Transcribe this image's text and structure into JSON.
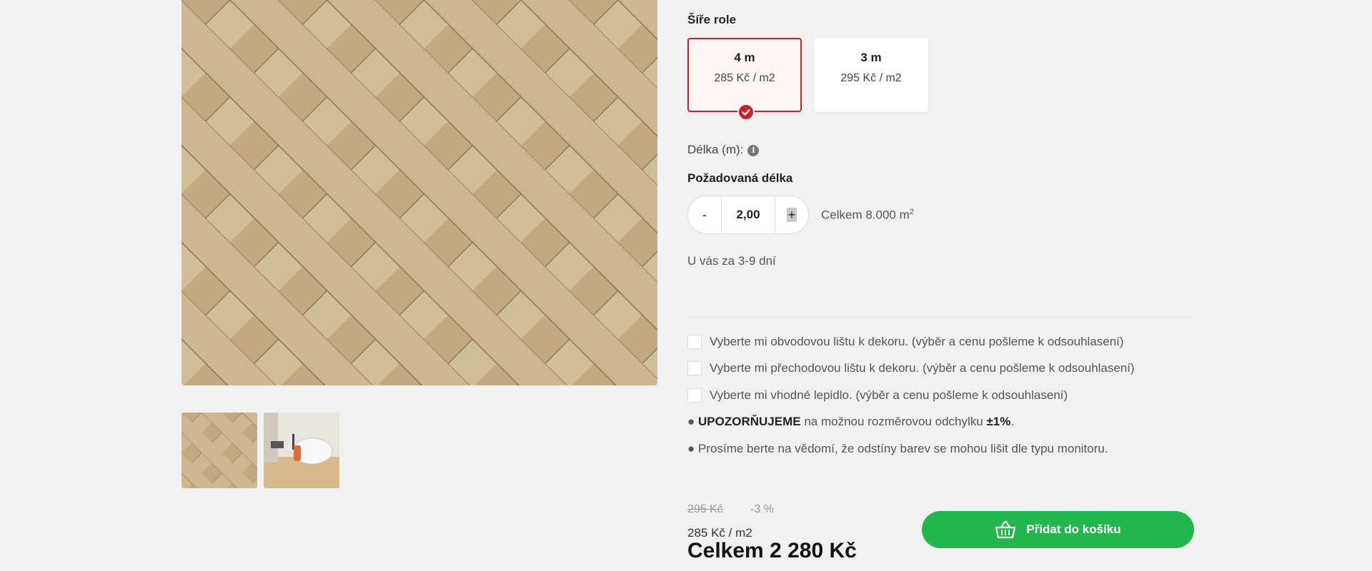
{
  "product_gallery": {
    "thumbnails": [
      "herringbone-floor-thumb",
      "bathroom-interior-thumb"
    ]
  },
  "roll_width": {
    "title": "Šíře role",
    "options": [
      {
        "width": "4 m",
        "price": "285 Kč / m2",
        "selected": true
      },
      {
        "width": "3 m",
        "price": "295 Kč / m2",
        "selected": false
      }
    ]
  },
  "length": {
    "label": "Délka (m):",
    "info_icon": "info-icon",
    "required_title": "Požadovaná délka",
    "minus_label": "-",
    "value": "2,00",
    "plus_label": "+",
    "total_prefix": "Celkem 8.000 m",
    "total_sup": "2"
  },
  "delivery": "U vás za 3-9 dní",
  "options_checkboxes": [
    "Vyberte mi obvodovou lištu k dekoru. (výběr a cenu pošleme k odsouhlasení)",
    "Vyberte mi přechodovou lištu k dekoru. (výběr a cenu pošleme k odsouhlasení)",
    "Vyberte mi vhodné lepidlo. (výběr a cenu pošleme k odsouhlasení)"
  ],
  "notes": {
    "bullet": "●",
    "warn_strong": "UPOZORŇUJEME",
    "warn_mid": " na možnou rozměrovou odchylku ",
    "warn_value": "±1%",
    "warn_end": ".",
    "colors": "Prosíme berte na vědomí, že odstíny barev se mohou lišit dle typu monitoru."
  },
  "pricing": {
    "old_price": "295 Kč",
    "discount": "-3 %",
    "unit_price": "285 Kč / m2",
    "total": "Celkem 2 280 Kč"
  },
  "cart_button": {
    "label": "Přidat do košíku",
    "icon": "basket-icon"
  },
  "colors": {
    "accent": "#c8222e",
    "cta": "#22b74c",
    "background": "#f1f1f1"
  }
}
